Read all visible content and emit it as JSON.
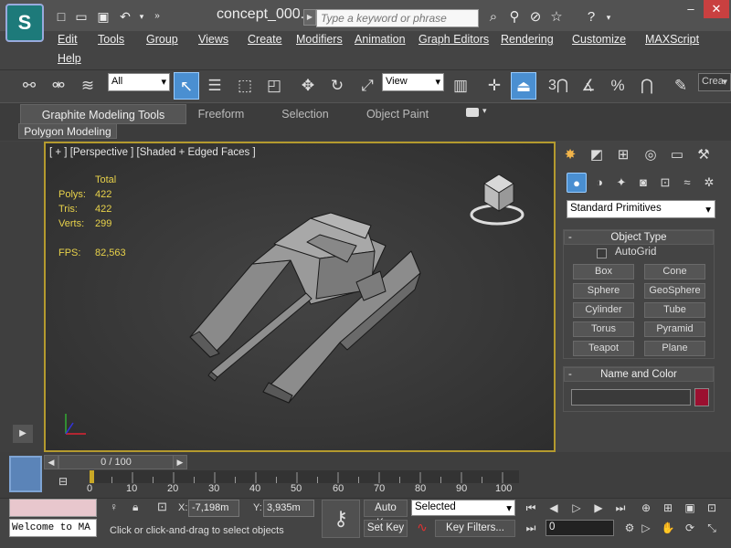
{
  "title_bar": {
    "title": "concept_000...",
    "search_placeholder": "Type a keyword or phrase",
    "logo_glyph": "S"
  },
  "menu": {
    "items": [
      "Edit",
      "Tools",
      "Group",
      "Views",
      "Create",
      "Modifiers",
      "Animation",
      "Graph Editors",
      "Rendering",
      "Customize",
      "MAXScript",
      "Help"
    ]
  },
  "toolbar": {
    "selection_filter": "All",
    "ref_coord": "View",
    "snap_number": "3",
    "named_set": "Crea"
  },
  "ribbon": {
    "tabs": [
      "Graphite Modeling Tools",
      "Freeform",
      "Selection",
      "Object Paint"
    ],
    "active_tab": 0,
    "panel_label": "Polygon Modeling"
  },
  "viewport": {
    "label": "[ + ] [Perspective ] [Shaded + Edged Faces ]",
    "stats": {
      "header": "Total",
      "polys_label": "Polys:",
      "polys": "422",
      "tris_label": "Tris:",
      "tris": "422",
      "verts_label": "Verts:",
      "verts": "299",
      "fps_label": "FPS:",
      "fps": "82,563"
    }
  },
  "command_panel": {
    "category_dropdown": "Standard Primitives",
    "object_type": {
      "header": "Object Type",
      "autogrid": "AutoGrid",
      "buttons": [
        "Box",
        "Cone",
        "Sphere",
        "GeoSphere",
        "Cylinder",
        "Tube",
        "Torus",
        "Pyramid",
        "Teapot",
        "Plane"
      ]
    },
    "name_color": {
      "header": "Name and Color",
      "name_value": "",
      "color": "#9b1030"
    }
  },
  "timeline": {
    "slider": "0 / 100",
    "ticks": [
      "0",
      "10",
      "20",
      "30",
      "40",
      "50",
      "60",
      "70",
      "80",
      "90",
      "100"
    ]
  },
  "status": {
    "maxscript_text": "Welcome to MA",
    "x_label": "X:",
    "x_value": "-7,198m",
    "y_label": "Y:",
    "y_value": "3,935m",
    "prompt": "Click or click-and-drag to select objects",
    "auto_key": "Auto Key",
    "set_key": "Set Key",
    "key_mode": "Selected",
    "key_filters": "Key Filters...",
    "frame": "0"
  },
  "colors": {
    "viewport_border": "#b49a2e",
    "active_tool": "#4a8fd1",
    "stats_text": "#e8d24a"
  }
}
